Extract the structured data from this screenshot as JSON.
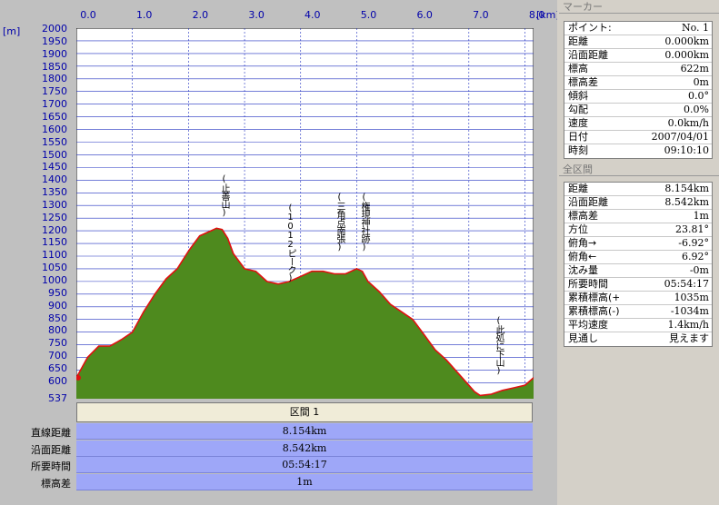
{
  "axes": {
    "x_unit": "[km]",
    "y_unit": "[m]",
    "x_ticks": [
      "0.0",
      "1.0",
      "2.0",
      "3.0",
      "4.0",
      "5.0",
      "6.0",
      "7.0",
      "8.0"
    ],
    "y_ticks": [
      "2000",
      "1950",
      "1900",
      "1850",
      "1800",
      "1750",
      "1700",
      "1650",
      "1600",
      "1550",
      "1500",
      "1450",
      "1400",
      "1350",
      "1300",
      "1250",
      "1200",
      "1150",
      "1100",
      "1050",
      "1000",
      "950",
      "900",
      "850",
      "800",
      "750",
      "700",
      "650",
      "600",
      "537"
    ]
  },
  "chart_data": {
    "type": "area",
    "xlim": [
      0,
      8.154
    ],
    "ylim": [
      537,
      2000
    ],
    "x": [
      0,
      0.2,
      0.4,
      0.6,
      0.8,
      1.0,
      1.2,
      1.4,
      1.6,
      1.8,
      2.0,
      2.1,
      2.2,
      2.3,
      2.4,
      2.5,
      2.6,
      2.7,
      2.8,
      3.0,
      3.2,
      3.4,
      3.6,
      3.8,
      4.0,
      4.2,
      4.4,
      4.6,
      4.8,
      5.0,
      5.1,
      5.2,
      5.4,
      5.6,
      5.8,
      6.0,
      6.2,
      6.4,
      6.6,
      6.8,
      7.0,
      7.1,
      7.2,
      7.4,
      7.6,
      7.8,
      8.0,
      8.154
    ],
    "y": [
      620,
      700,
      745,
      745,
      770,
      800,
      880,
      950,
      1010,
      1050,
      1120,
      1150,
      1180,
      1190,
      1200,
      1210,
      1205,
      1170,
      1110,
      1050,
      1040,
      1000,
      990,
      1000,
      1020,
      1040,
      1040,
      1030,
      1030,
      1050,
      1040,
      1000,
      960,
      910,
      880,
      850,
      790,
      730,
      690,
      640,
      590,
      565,
      550,
      555,
      570,
      580,
      590,
      620
    ],
    "line_color": "#e01010",
    "fill_color": "#4e8a1e",
    "background": "#ffffff",
    "grid_color": "#2030c0",
    "grid": true
  },
  "annotations": [
    {
      "text": "(止善山)"
    },
    {
      "text": "(1012ピーク)"
    },
    {
      "text": "(三角点南張)"
    },
    {
      "text": "(権現神社跡)"
    },
    {
      "text": "(此処に下山)"
    }
  ],
  "section": {
    "title": "区間 1",
    "stats": [
      {
        "label": "直線距離",
        "value": "8.154km"
      },
      {
        "label": "沿面距離",
        "value": "8.542km"
      },
      {
        "label": "所要時間",
        "value": "05:54:17"
      },
      {
        "label": "標高差",
        "value": "1m"
      }
    ]
  },
  "marker_panel": {
    "title": "マーカー",
    "rows": [
      {
        "k": "ポイント:",
        "v": "No. 1"
      },
      {
        "k": "距離",
        "v": "0.000km"
      },
      {
        "k": "沿面距離",
        "v": "0.000km"
      },
      {
        "k": "標高",
        "v": "622m"
      },
      {
        "k": "標高差",
        "v": "0m"
      },
      {
        "k": "傾斜",
        "v": "0.0°"
      },
      {
        "k": "勾配",
        "v": "0.0%"
      },
      {
        "k": "速度",
        "v": "0.0km/h"
      },
      {
        "k": "日付",
        "v": "2007/04/01"
      },
      {
        "k": "時刻",
        "v": "09:10:10"
      }
    ]
  },
  "all_section_panel": {
    "title": "全区間",
    "rows": [
      {
        "k": "距離",
        "v": "8.154km"
      },
      {
        "k": "沿面距離",
        "v": "8.542km"
      },
      {
        "k": "標高差",
        "v": "1m"
      },
      {
        "k": "方位",
        "v": "23.81°"
      },
      {
        "k": "俯角→",
        "v": "-6.92°"
      },
      {
        "k": "俯角←",
        "v": "6.92°"
      },
      {
        "k": "沈み量",
        "v": "-0m"
      },
      {
        "k": "所要時間",
        "v": "05:54:17"
      },
      {
        "k": "累積標高(+)",
        "v": "1035m"
      },
      {
        "k": "累積標高(-)",
        "v": "-1034m"
      },
      {
        "k": "平均速度",
        "v": "1.4km/h"
      },
      {
        "k": "見通し",
        "v": "見えます"
      }
    ]
  }
}
